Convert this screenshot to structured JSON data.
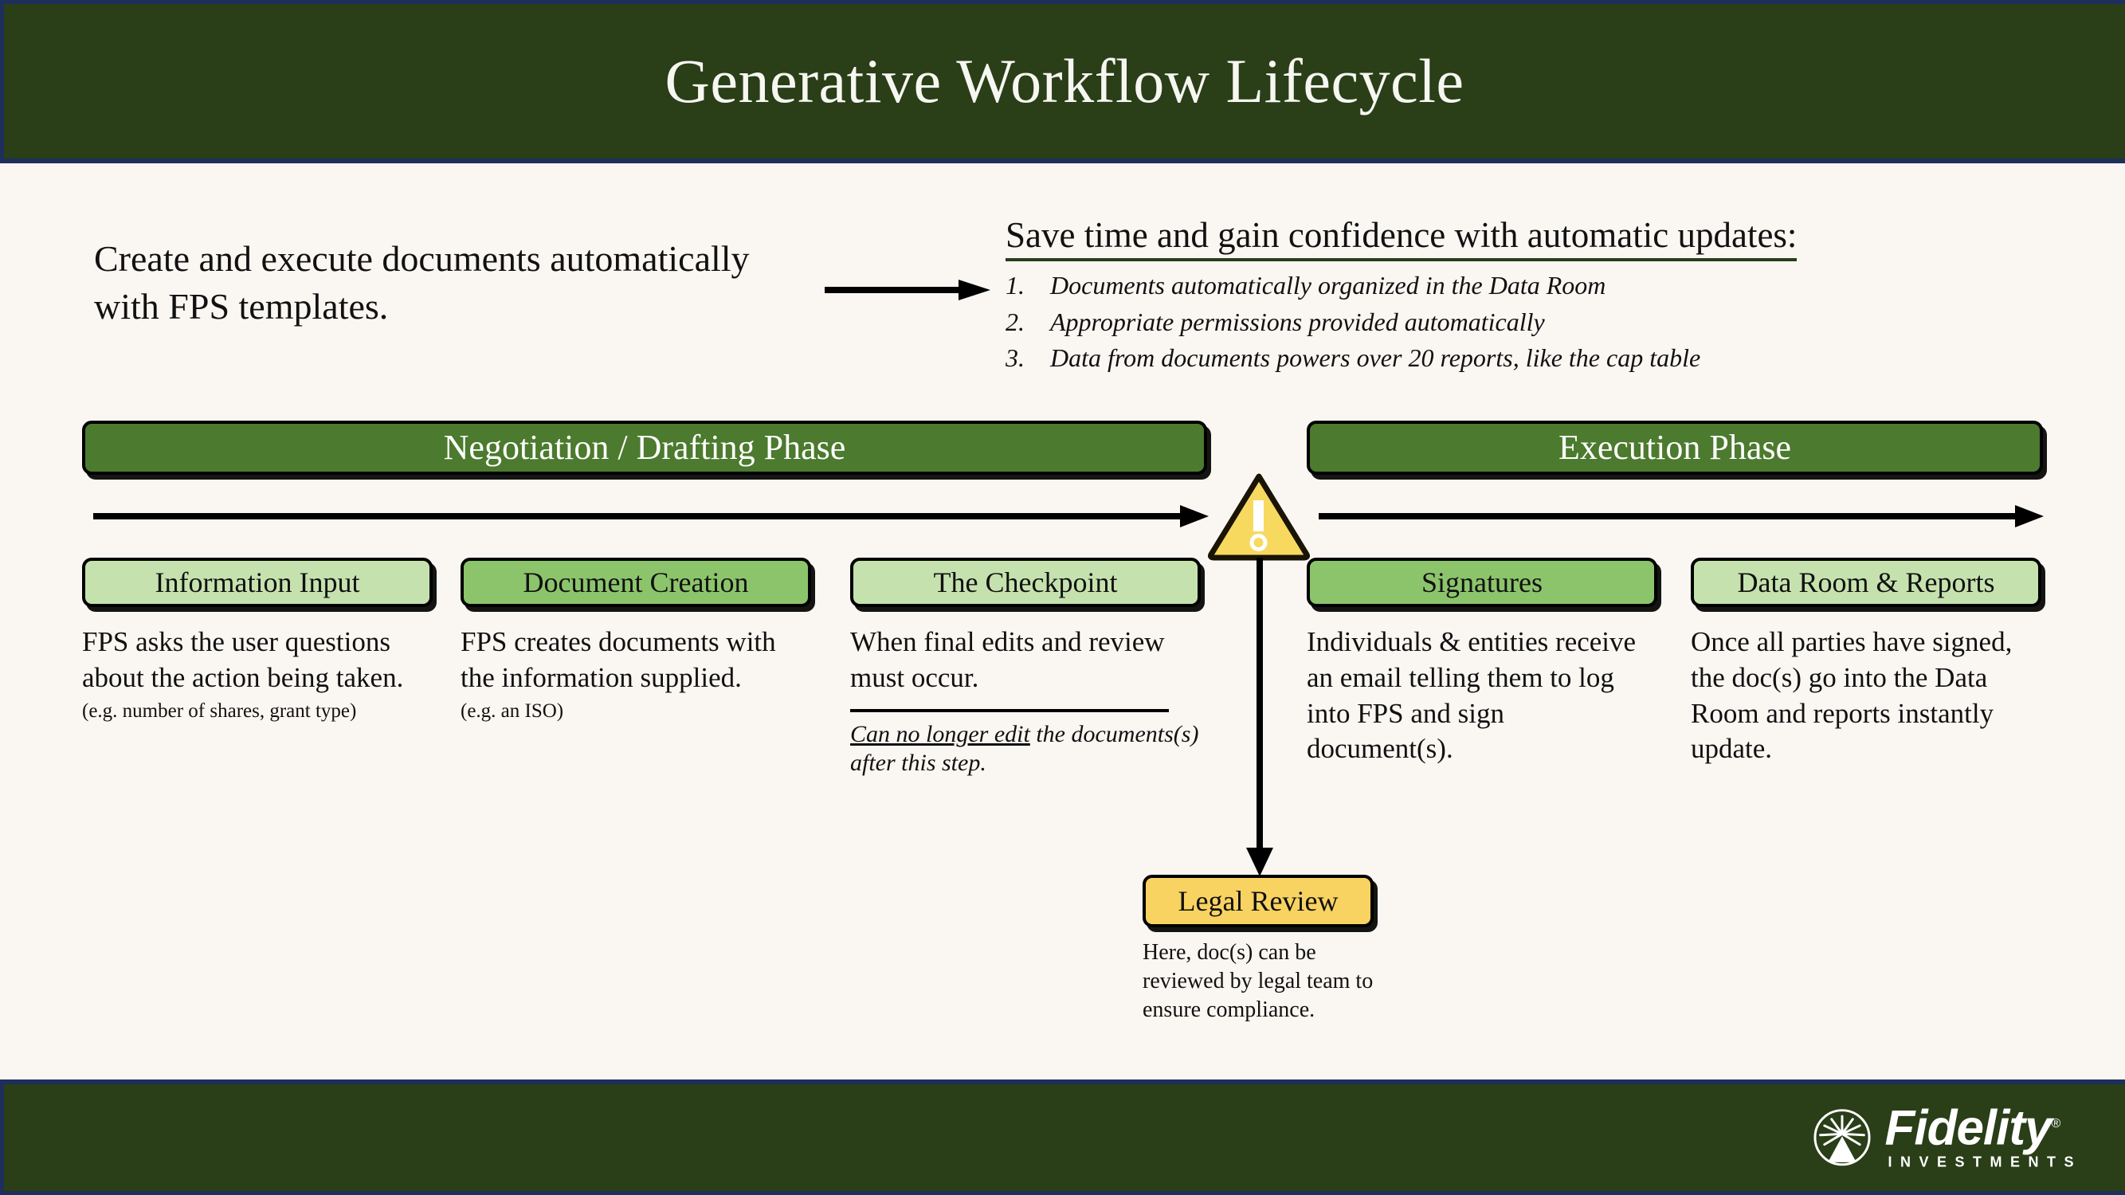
{
  "header": {
    "title": "Generative Workflow Lifecycle",
    "band_color": "#1E2F5C",
    "bg_color": "#2A3E18"
  },
  "intro": {
    "left_text": "Create and execute documents automatically with FPS templates.",
    "arrow_icon": "right-arrow-icon",
    "right_heading": "Save time and gain confidence with automatic updates:",
    "right_items": [
      {
        "num": "1.",
        "text": "Documents automatically organized in the Data Room"
      },
      {
        "num": "2.",
        "text": "Appropriate permissions provided automatically"
      },
      {
        "num": "3.",
        "text": "Data from documents powers over 20 reports, like the cap table"
      }
    ]
  },
  "phases": {
    "negotiation_label": "Negotiation / Drafting Phase",
    "execution_label": "Execution Phase",
    "bar_color": "#4C7A2E"
  },
  "warning": {
    "icon": "warning-triangle-icon",
    "fill": "#F8D95F",
    "glyph": "!"
  },
  "steps": [
    {
      "id": "info",
      "label": "Information Input",
      "tone": "#C5E2AE",
      "body": "FPS asks the user questions about the action being taken.",
      "sub": "(e.g. number of shares, grant type)"
    },
    {
      "id": "doc",
      "label": "Document Creation",
      "tone": "#8CC46C",
      "body": "FPS creates documents with the information supplied.",
      "sub": "(e.g. an ISO)"
    },
    {
      "id": "check",
      "label": "The Checkpoint",
      "tone": "#C5E2AE",
      "body": "When final edits and review must occur.",
      "note_underlined": "Can no longer edit",
      "note_rest": " the documents(s) after this step."
    },
    {
      "id": "sig",
      "label": "Signatures",
      "tone": "#8CC46C",
      "body": "Individuals & entities receive an email telling them to log into FPS and sign document(s)."
    },
    {
      "id": "data",
      "label": "Data Room & Reports",
      "tone": "#C5E2AE",
      "body": "Once all parties have signed, the doc(s) go into the Data Room and reports instantly update."
    }
  ],
  "legal": {
    "label": "Legal Review",
    "tone": "#F9D362",
    "body": "Here, doc(s) can be reviewed by legal team to ensure compliance."
  },
  "footer": {
    "brand_name": "Fidelity",
    "brand_reg": "®",
    "brand_sub": "INVESTMENTS",
    "logo_icon": "fidelity-pyramid-icon",
    "band_color": "#1E2F5C",
    "bg_color": "#2A3E18"
  }
}
